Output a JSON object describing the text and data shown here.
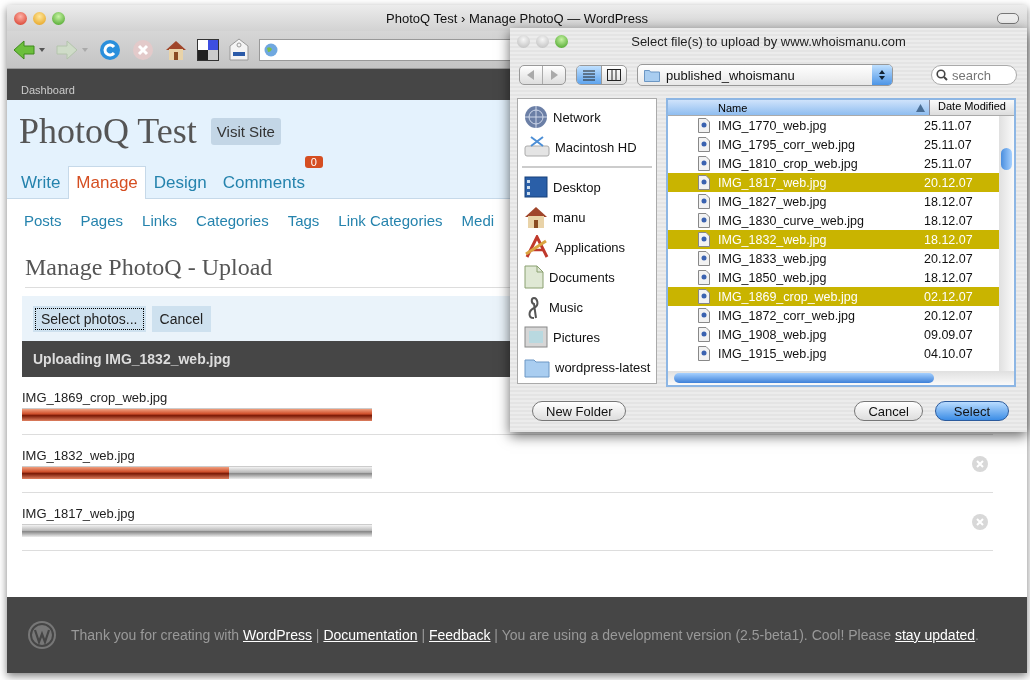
{
  "browser": {
    "title": "PhotoQ Test › Manage PhotoQ — WordPress"
  },
  "admin": {
    "top_link": "Dashboard",
    "site_title": "PhotoQ Test",
    "visit_site": "Visit Site",
    "tabs": [
      {
        "label": "Write",
        "selected": false
      },
      {
        "label": "Manage",
        "selected": true
      },
      {
        "label": "Design",
        "selected": false
      },
      {
        "label": "Comments",
        "selected": false,
        "badge": "0"
      }
    ],
    "submenu": [
      "Posts",
      "Pages",
      "Links",
      "Categories",
      "Tags",
      "Link Categories",
      "Medi"
    ],
    "heading": "Manage PhotoQ - Upload",
    "buttons": [
      {
        "label": "Select photos...",
        "focused": true
      },
      {
        "label": "Cancel",
        "focused": false
      }
    ],
    "upload_status": "Uploading IMG_1832_web.jpg",
    "uploads": [
      {
        "name": "IMG_1869_crop_web.jpg",
        "level": 1
      },
      {
        "name": "IMG_1832_web.jpg",
        "level": 0.59
      },
      {
        "name": "IMG_1817_web.jpg",
        "level": 0
      }
    ],
    "footer": [
      {
        "kind": "text",
        "text": "Thank you for creating with "
      },
      {
        "kind": "link",
        "text": "WordPress"
      },
      {
        "kind": "text",
        "text": " | "
      },
      {
        "kind": "link",
        "text": "Documentation"
      },
      {
        "kind": "text",
        "text": " | "
      },
      {
        "kind": "link",
        "text": "Feedback"
      },
      {
        "kind": "text",
        "text": " | You are using a development version (2.5-beta1). Cool! Please "
      },
      {
        "kind": "link",
        "text": "stay updated"
      },
      {
        "kind": "text",
        "text": "."
      }
    ]
  },
  "dialog": {
    "title": "Select file(s) to upload by www.whoismanu.com",
    "view_modes": [
      {
        "kind": "list",
        "selected": true
      },
      {
        "kind": "columns",
        "selected": false
      }
    ],
    "folder": "published_whoismanu",
    "search": {
      "placeholder": "search"
    },
    "devices": [
      {
        "label": "Network",
        "kind": "network"
      },
      {
        "label": "Macintosh HD",
        "kind": "drive"
      }
    ],
    "places": [
      {
        "label": "Desktop",
        "kind": "desktop"
      },
      {
        "label": "manu",
        "kind": "home"
      },
      {
        "label": "Applications",
        "kind": "applications"
      },
      {
        "label": "Documents",
        "kind": "document"
      },
      {
        "label": "Music",
        "kind": "music"
      },
      {
        "label": "Pictures",
        "kind": "pictures"
      },
      {
        "label": "wordpress-latest",
        "kind": "folder"
      }
    ],
    "columns": [
      "Name",
      "Date Modified"
    ],
    "files": [
      {
        "name": "IMG_1770_web.jpg",
        "date": "25.11.07",
        "selected": false
      },
      {
        "name": "IMG_1795_corr_web.jpg",
        "date": "25.11.07",
        "selected": false
      },
      {
        "name": "IMG_1810_crop_web.jpg",
        "date": "25.11.07",
        "selected": false
      },
      {
        "name": "IMG_1817_web.jpg",
        "date": "20.12.07",
        "selected": true
      },
      {
        "name": "IMG_1827_web.jpg",
        "date": "18.12.07",
        "selected": false
      },
      {
        "name": "IMG_1830_curve_web.jpg",
        "date": "18.12.07",
        "selected": false
      },
      {
        "name": "IMG_1832_web.jpg",
        "date": "18.12.07",
        "selected": true
      },
      {
        "name": "IMG_1833_web.jpg",
        "date": "20.12.07",
        "selected": false
      },
      {
        "name": "IMG_1850_web.jpg",
        "date": "18.12.07",
        "selected": false
      },
      {
        "name": "IMG_1869_crop_web.jpg",
        "date": "02.12.07",
        "selected": true
      },
      {
        "name": "IMG_1872_corr_web.jpg",
        "date": "20.12.07",
        "selected": false
      },
      {
        "name": "IMG_1908_web.jpg",
        "date": "09.09.07",
        "selected": false
      },
      {
        "name": "IMG_1915_web.jpg",
        "date": "04.10.07",
        "selected": false
      }
    ],
    "buttons": [
      {
        "label": "New Folder",
        "default": false
      },
      {
        "label": "Cancel",
        "default": false
      },
      {
        "label": "Select",
        "default": true
      }
    ]
  }
}
